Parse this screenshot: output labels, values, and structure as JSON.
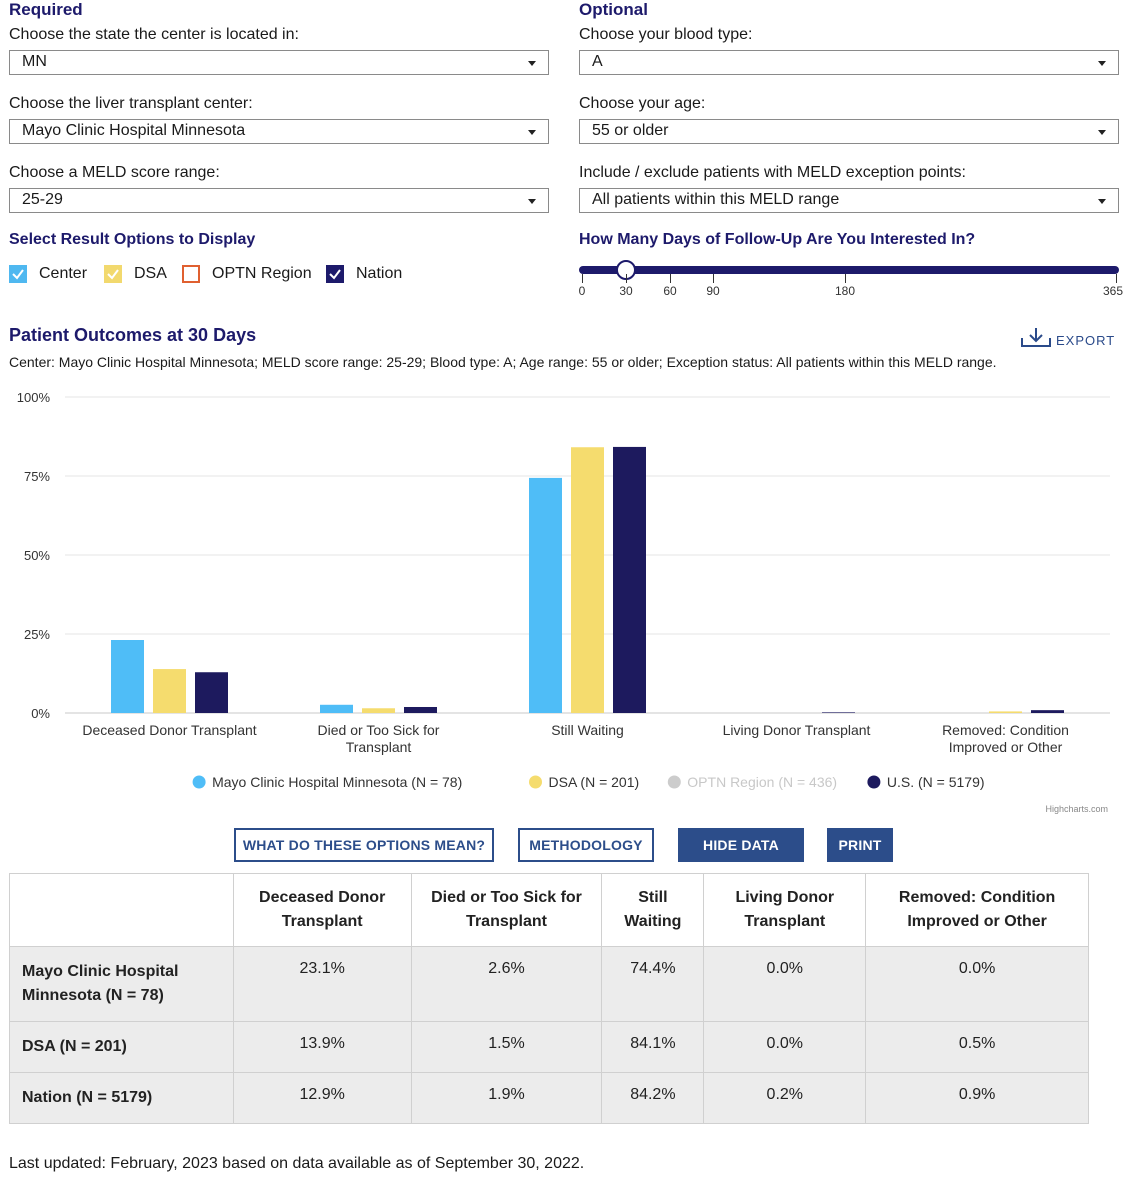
{
  "required": {
    "heading": "Required",
    "state_label": "Choose the state the center is located in:",
    "state_value": "MN",
    "center_label": "Choose the liver transplant center:",
    "center_value": "Mayo Clinic Hospital Minnesota",
    "meld_label": "Choose a MELD score range:",
    "meld_value": "25-29"
  },
  "optional": {
    "heading": "Optional",
    "blood_label": "Choose your blood type:",
    "blood_value": "A",
    "age_label": "Choose your age:",
    "age_value": "55 or older",
    "exception_label": "Include / exclude patients with MELD exception points:",
    "exception_value": "All patients within this MELD range"
  },
  "result_options": {
    "title": "Select Result Options to Display",
    "items": [
      {
        "label": "Center",
        "checked": true,
        "color": "#4fb8f0"
      },
      {
        "label": "DSA",
        "checked": true,
        "color": "#f2d96e"
      },
      {
        "label": "OPTN Region",
        "checked": false,
        "color": "#e06030"
      },
      {
        "label": "Nation",
        "checked": true,
        "color": "#1d1a6b"
      }
    ]
  },
  "followup": {
    "title": "How Many Days of Follow-Up Are You Interested In?",
    "selected": 30,
    "ticks": [
      "0",
      "30",
      "60",
      "90",
      "180",
      "365"
    ]
  },
  "chart_header": {
    "title": "Patient Outcomes at 30 Days",
    "export": "EXPORT",
    "subtitle": "Center: Mayo Clinic Hospital Minnesota; MELD score range: 25-29; Blood type: A; Age range: 55 or older; Exception status: All patients within this MELD range."
  },
  "chart_data": {
    "type": "bar",
    "categories": [
      "Deceased Donor Transplant",
      "Died or Too Sick for Transplant",
      "Still Waiting",
      "Living Donor Transplant",
      "Removed: Condition Improved or Other"
    ],
    "y_ticks": [
      "100%",
      "75%",
      "50%",
      "25%",
      "0%"
    ],
    "ylim": [
      0,
      100
    ],
    "grid": true,
    "legend_position": "bottom",
    "credit": "Highcharts.com",
    "series": [
      {
        "name": "Mayo Clinic Hospital Minnesota (N = 78)",
        "color": "#4fbdf7",
        "visible": true,
        "values": [
          23.1,
          2.6,
          74.4,
          0.0,
          0.0
        ]
      },
      {
        "name": "DSA (N = 201)",
        "color": "#f5dc6e",
        "visible": true,
        "values": [
          13.9,
          1.5,
          84.1,
          0.0,
          0.5
        ]
      },
      {
        "name": "OPTN Region (N = 436)",
        "color": "#cccccc",
        "visible": false,
        "values": []
      },
      {
        "name": "U.S. (N = 5179)",
        "color": "#1d1a5e",
        "visible": true,
        "values": [
          12.9,
          1.9,
          84.2,
          0.2,
          0.9
        ]
      }
    ]
  },
  "buttons": {
    "options": "WHAT DO THESE OPTIONS MEAN?",
    "methodology": "METHODOLOGY",
    "hide": "HIDE DATA",
    "print": "PRINT"
  },
  "table": {
    "headers": [
      "",
      "Deceased Donor Transplant",
      "Died or Too Sick for Transplant",
      "Still Waiting",
      "Living Donor Transplant",
      "Removed: Condition Improved or Other"
    ],
    "rows": [
      {
        "label": "Mayo Clinic Hospital Minnesota (N = 78)",
        "values": [
          "23.1%",
          "2.6%",
          "74.4%",
          "0.0%",
          "0.0%"
        ]
      },
      {
        "label": "DSA (N = 201)",
        "values": [
          "13.9%",
          "1.5%",
          "84.1%",
          "0.0%",
          "0.5%"
        ]
      },
      {
        "label": "Nation (N = 5179)",
        "values": [
          "12.9%",
          "1.9%",
          "84.2%",
          "0.2%",
          "0.9%"
        ]
      }
    ]
  },
  "footer": {
    "updated": "Last updated: February, 2023 based on data available as of September 30, 2022."
  }
}
